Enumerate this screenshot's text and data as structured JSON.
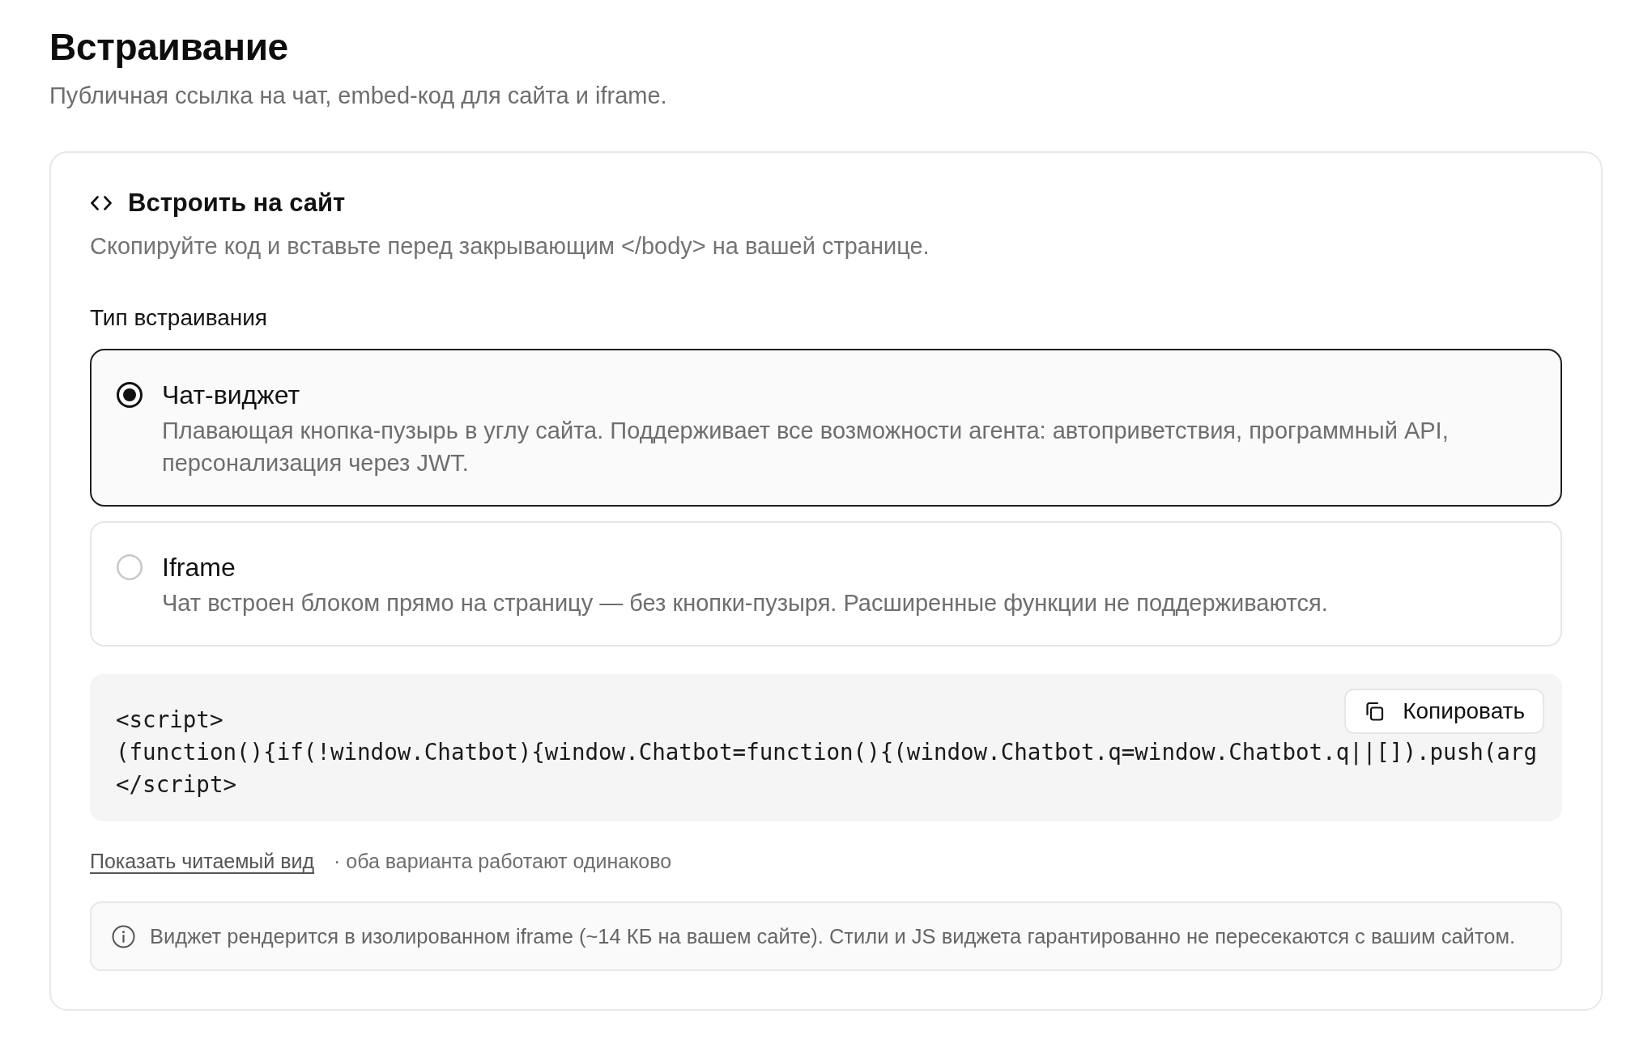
{
  "page": {
    "title": "Встраивание",
    "subtitle": "Публичная ссылка на чат, embed-код для сайта и iframe."
  },
  "embed_card": {
    "title": "Встроить на сайт",
    "description": "Скопируйте код и вставьте перед закрывающим </body> на вашей странице.",
    "type_label": "Тип встраивания",
    "options": [
      {
        "title": "Чат-виджет",
        "description": "Плавающая кнопка-пузырь в углу сайта. Поддерживает все возможности агента: автоприветствия, программный API, персонализация через JWT.",
        "selected": true
      },
      {
        "title": "Iframe",
        "description": "Чат встроен блоком прямо на страницу — без кнопки-пузыря. Расширенные функции не поддерживаются.",
        "selected": false
      }
    ],
    "code": {
      "lines": [
        "<script>",
        "(function(){if(!window.Chatbot){window.Chatbot=function(){(window.Chatbot.q=window.Chatbot.q||[]).push(arg",
        "</script>"
      ],
      "copy_button": "Копировать"
    },
    "readable_link": "Показать читаемый вид",
    "note": "· оба варианта работают одинаково",
    "info": "Виджет рендерится в изолированном iframe (~14 КБ на вашем сайте). Стили и JS виджета гарантированно не пересекаются с вашим сайтом."
  }
}
